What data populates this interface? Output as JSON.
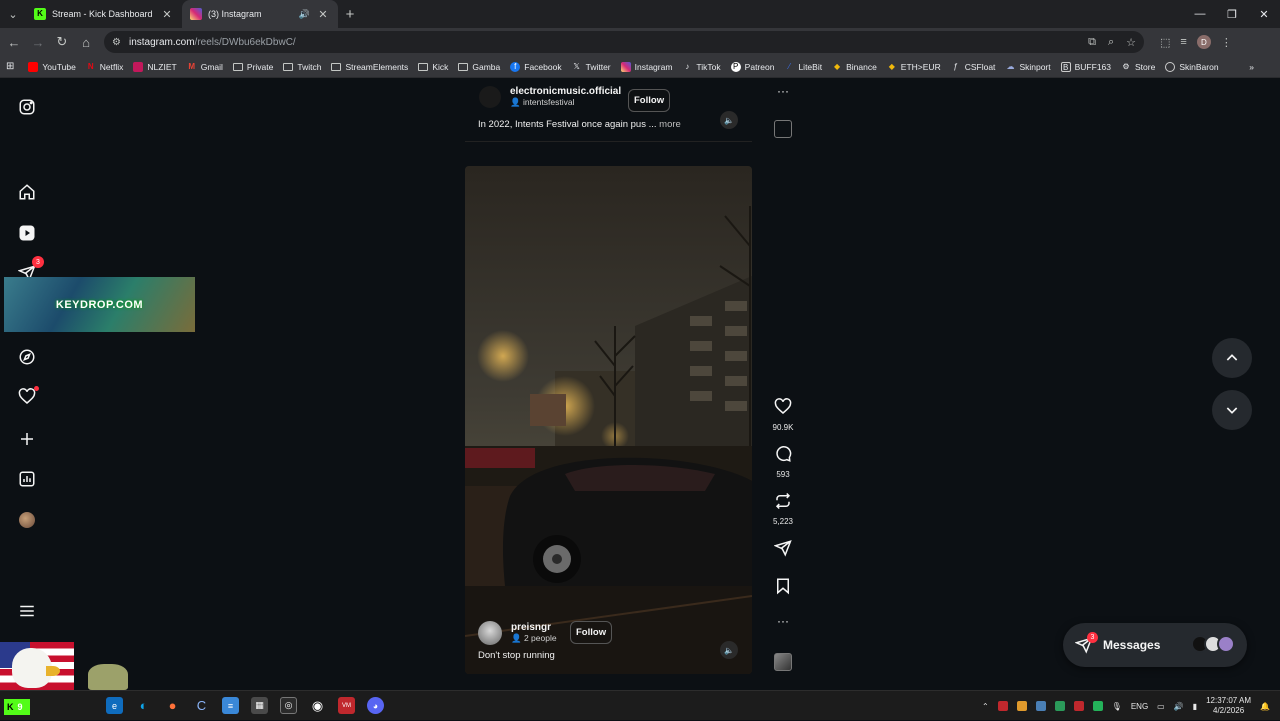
{
  "browser": {
    "tabs": [
      {
        "title": "Stream - Kick Dashboard",
        "favicon": "kick-icon",
        "color": "#53fc18"
      },
      {
        "title": "(3) Instagram",
        "favicon": "instagram-icon",
        "color": "#d62976"
      }
    ],
    "url_host": "instagram.com",
    "url_path": "/reels/DWbu6ekDbwC/",
    "profile_initial": "D",
    "bookmarks": [
      "YouTube",
      "Netflix",
      "NLZIET",
      "Gmail",
      "Private",
      "Twitch",
      "StreamElements",
      "Kick",
      "Gamba",
      "Facebook",
      "Twitter",
      "Instagram",
      "TikTok",
      "Patreon",
      "LiteBit",
      "Binance",
      "ETH>EUR",
      "CSFloat",
      "Skinport",
      "BUFF163",
      "Store",
      "SkinBaron"
    ]
  },
  "sidebar": {
    "notifications_badge": "3"
  },
  "overlay": {
    "keydrop": "KEYDROP.COM"
  },
  "reel_prev": {
    "username": "electronicmusic.official",
    "collab": "intentsfestival",
    "follow": "Follow",
    "caption": "In 2022, Intents Festival once again pus ...",
    "more": "more"
  },
  "reel": {
    "username": "preisngr",
    "collab": "2 people",
    "follow": "Follow",
    "caption": "Don't stop running"
  },
  "actions": {
    "likes": "90.9K",
    "comments": "593",
    "reposts": "5,223"
  },
  "messages": {
    "label": "Messages",
    "badge": "3"
  },
  "taskbar": {
    "kick_count": "9",
    "lang": "ENG",
    "time": "12:37:07 AM",
    "date": "4/2/2026"
  }
}
